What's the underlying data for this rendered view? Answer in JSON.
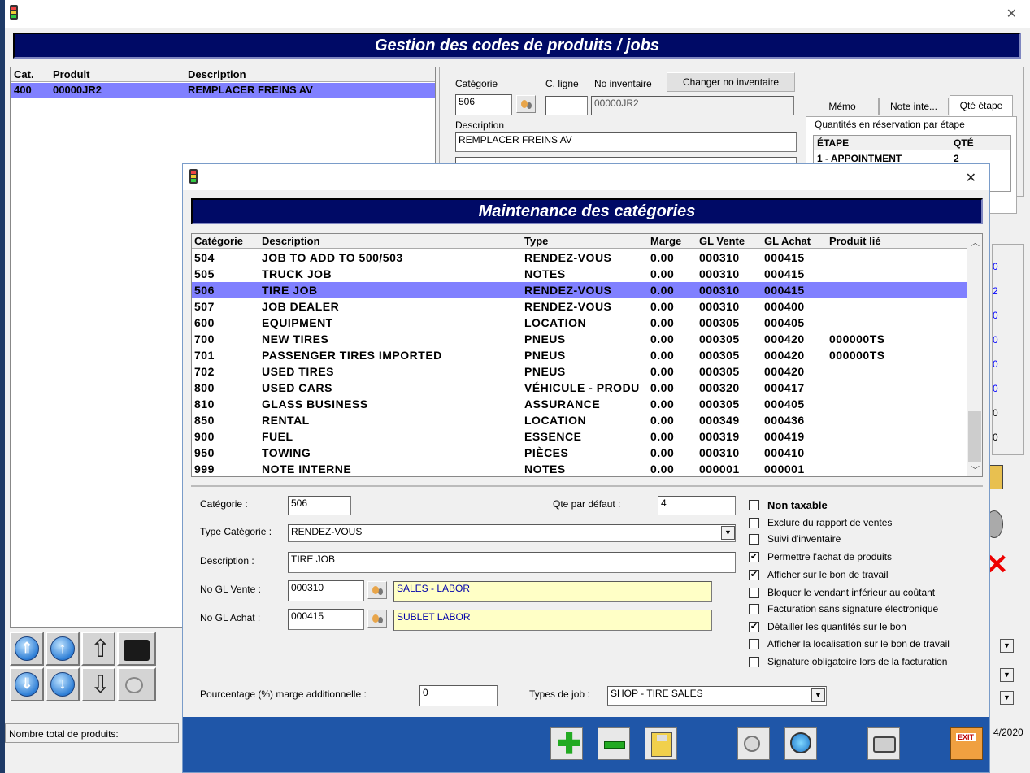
{
  "main_window": {
    "title": "Gestion des codes de produits / jobs",
    "close_glyph": "✕",
    "list_headers": [
      "Cat.",
      "Produit",
      "Description"
    ],
    "rows": [
      {
        "cat": "400",
        "produit": "00000JR2",
        "description": "REMPLACER FREINS AV"
      }
    ],
    "form": {
      "categorie_label": "Catégorie",
      "c_ligne_label": "C. ligne",
      "no_inventaire_label": "No inventaire",
      "changer_button": "Changer no inventaire",
      "categorie_value": "506",
      "c_ligne_value": "",
      "no_inventaire_value": "00000JR2",
      "description_label": "Description",
      "description_value": "REMPLACER FREINS AV"
    },
    "tabs": [
      "Mémo",
      "Note inte...",
      "Qté étape"
    ],
    "reservation_group": "Quantités en réservation par étape",
    "etape_headers": [
      "ÉTAPE",
      "QTÉ"
    ],
    "etape_rows": [
      {
        "etape": "1 - APPOINTMENT",
        "qte": "2"
      }
    ],
    "status_label": "Nombre total de produits:",
    "date_fragment": "4/2020",
    "side_values": [
      "0",
      "2",
      "0",
      "0",
      "0",
      "0",
      "0",
      "0"
    ]
  },
  "dialog": {
    "title": "Maintenance des catégories",
    "close_glyph": "✕",
    "headers": [
      "Catégorie",
      "Description",
      "Type",
      "Marge",
      "GL Vente",
      "GL Achat",
      "Produit lié"
    ],
    "rows": [
      {
        "cat": "504",
        "desc": "JOB TO ADD TO 500/503",
        "type": "RENDEZ-VOUS",
        "marge": "0.00",
        "vente": "000310",
        "achat": "000415",
        "lie": ""
      },
      {
        "cat": "505",
        "desc": "TRUCK JOB",
        "type": "NOTES",
        "marge": "0.00",
        "vente": "000310",
        "achat": "000415",
        "lie": ""
      },
      {
        "cat": "506",
        "desc": "TIRE JOB",
        "type": "RENDEZ-VOUS",
        "marge": "0.00",
        "vente": "000310",
        "achat": "000415",
        "lie": ""
      },
      {
        "cat": "507",
        "desc": "JOB DEALER",
        "type": "RENDEZ-VOUS",
        "marge": "0.00",
        "vente": "000310",
        "achat": "000400",
        "lie": ""
      },
      {
        "cat": "600",
        "desc": "EQUIPMENT",
        "type": "LOCATION",
        "marge": "0.00",
        "vente": "000305",
        "achat": "000405",
        "lie": ""
      },
      {
        "cat": "700",
        "desc": "NEW TIRES",
        "type": "PNEUS",
        "marge": "0.00",
        "vente": "000305",
        "achat": "000420",
        "lie": "000000TS"
      },
      {
        "cat": "701",
        "desc": "PASSENGER TIRES IMPORTED",
        "type": "PNEUS",
        "marge": "0.00",
        "vente": "000305",
        "achat": "000420",
        "lie": "000000TS"
      },
      {
        "cat": "702",
        "desc": "USED TIRES",
        "type": "PNEUS",
        "marge": "0.00",
        "vente": "000305",
        "achat": "000420",
        "lie": ""
      },
      {
        "cat": "800",
        "desc": "USED CARS",
        "type": "VÉHICULE - PRODU",
        "marge": "0.00",
        "vente": "000320",
        "achat": "000417",
        "lie": ""
      },
      {
        "cat": "810",
        "desc": "GLASS BUSINESS",
        "type": "ASSURANCE",
        "marge": "0.00",
        "vente": "000305",
        "achat": "000405",
        "lie": ""
      },
      {
        "cat": "850",
        "desc": "RENTAL",
        "type": "LOCATION",
        "marge": "0.00",
        "vente": "000349",
        "achat": "000436",
        "lie": ""
      },
      {
        "cat": "900",
        "desc": "FUEL",
        "type": "ESSENCE",
        "marge": "0.00",
        "vente": "000319",
        "achat": "000419",
        "lie": ""
      },
      {
        "cat": "950",
        "desc": "TOWING",
        "type": "PIÈCES",
        "marge": "0.00",
        "vente": "000310",
        "achat": "000410",
        "lie": ""
      },
      {
        "cat": "999",
        "desc": "NOTE INTERNE",
        "type": "NOTES",
        "marge": "0.00",
        "vente": "000001",
        "achat": "000001",
        "lie": ""
      }
    ],
    "selected_index": 2,
    "form": {
      "categorie_label": "Catégorie :",
      "categorie_value": "506",
      "qte_label": "Qte par défaut :",
      "qte_value": "4",
      "type_label": "Type Catégorie :",
      "type_value": "RENDEZ-VOUS",
      "description_label": "Description :",
      "description_value": "TIRE JOB",
      "gl_vente_label": "No GL Vente :",
      "gl_vente_value": "000310",
      "gl_vente_desc": "SALES - LABOR",
      "gl_achat_label": "No GL Achat :",
      "gl_achat_value": "000415",
      "gl_achat_desc": "SUBLET LABOR",
      "marge_label": "Pourcentage (%) marge additionnelle :",
      "marge_value": "0",
      "types_job_label": "Types de job :",
      "types_job_value": "SHOP - TIRE SALES"
    },
    "checkboxes": [
      {
        "label": "Non taxable",
        "checked": false,
        "bold": true
      },
      {
        "label": "Exclure du rapport de ventes",
        "checked": false
      },
      {
        "label": "Suivi d'inventaire",
        "checked": false
      },
      {
        "label": "Permettre l'achat de produits",
        "checked": true
      },
      {
        "label": "Afficher sur le bon de travail",
        "checked": true
      },
      {
        "label": "Bloquer le vendant inférieur au coûtant",
        "checked": false
      },
      {
        "label": "Facturation sans signature électronique",
        "checked": false
      },
      {
        "label": "Détailler les quantités sur le bon",
        "checked": true
      },
      {
        "label": "Afficher la localisation sur le bon de travail",
        "checked": false
      },
      {
        "label": "Signature obligatoire lors de la facturation",
        "checked": false
      }
    ],
    "toolbar_icons": [
      "add-icon",
      "remove-icon",
      "save-icon",
      "search-icon",
      "zoom-icon",
      "print-icon",
      "exit-icon"
    ],
    "exit_label": "EXIT"
  },
  "colors": {
    "banner": "#000a66",
    "selection": "#8080ff",
    "field_yellow": "#ffffc6"
  }
}
